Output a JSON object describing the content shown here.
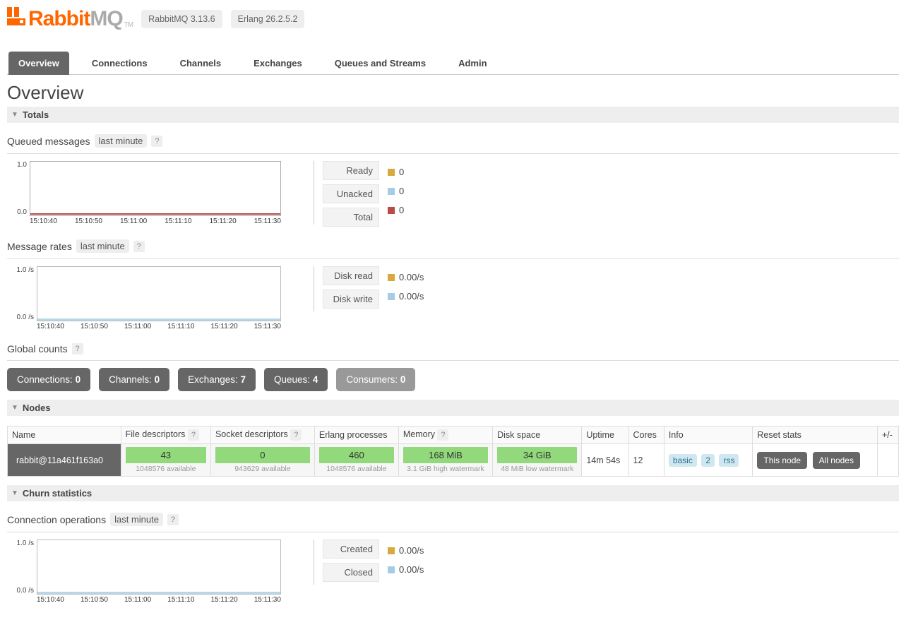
{
  "header": {
    "product_a": "Rabbit",
    "product_b": "MQ",
    "tm": "TM",
    "version": "RabbitMQ 3.13.6",
    "erlang": "Erlang 26.2.5.2"
  },
  "tabs": [
    "Overview",
    "Connections",
    "Channels",
    "Exchanges",
    "Queues and Streams",
    "Admin"
  ],
  "active_tab": 0,
  "page_title": "Overview",
  "sections": {
    "totals": "Totals",
    "nodes": "Nodes",
    "churn": "Churn statistics"
  },
  "queued": {
    "title": "Queued messages",
    "range": "last minute",
    "help": "?",
    "legend": [
      {
        "label": "Ready",
        "value": "0",
        "swatch": "gold"
      },
      {
        "label": "Unacked",
        "value": "0",
        "swatch": "blue"
      },
      {
        "label": "Total",
        "value": "0",
        "swatch": "red"
      }
    ]
  },
  "rates": {
    "title": "Message rates",
    "range": "last minute",
    "help": "?",
    "legend": [
      {
        "label": "Disk read",
        "value": "0.00/s",
        "swatch": "gold"
      },
      {
        "label": "Disk write",
        "value": "0.00/s",
        "swatch": "blue"
      }
    ]
  },
  "chart_data": [
    {
      "type": "line",
      "title": "Queued messages",
      "xlabel": "",
      "ylabel": "",
      "ylim": [
        0,
        1.0
      ],
      "x": [
        "15:10:40",
        "15:10:50",
        "15:11:00",
        "15:11:10",
        "15:11:20",
        "15:11:30"
      ],
      "series": [
        {
          "name": "Ready",
          "values": [
            0,
            0,
            0,
            0,
            0,
            0
          ]
        },
        {
          "name": "Unacked",
          "values": [
            0,
            0,
            0,
            0,
            0,
            0
          ]
        },
        {
          "name": "Total",
          "values": [
            0,
            0,
            0,
            0,
            0,
            0
          ]
        }
      ],
      "y_ticks": [
        "1.0",
        "0.0"
      ]
    },
    {
      "type": "line",
      "title": "Message rates",
      "xlabel": "",
      "ylabel": "/s",
      "ylim": [
        0,
        1.0
      ],
      "x": [
        "15:10:40",
        "15:10:50",
        "15:11:00",
        "15:11:10",
        "15:11:20",
        "15:11:30"
      ],
      "series": [
        {
          "name": "Disk read",
          "values": [
            0,
            0,
            0,
            0,
            0,
            0
          ]
        },
        {
          "name": "Disk write",
          "values": [
            0,
            0,
            0,
            0,
            0,
            0
          ]
        }
      ],
      "y_ticks": [
        "1.0 /s",
        "0.0 /s"
      ]
    },
    {
      "type": "line",
      "title": "Connection operations",
      "xlabel": "",
      "ylabel": "/s",
      "ylim": [
        0,
        1.0
      ],
      "x": [
        "15:10:40",
        "15:10:50",
        "15:11:00",
        "15:11:10",
        "15:11:20",
        "15:11:30"
      ],
      "series": [
        {
          "name": "Created",
          "values": [
            0,
            0,
            0,
            0,
            0,
            0
          ]
        },
        {
          "name": "Closed",
          "values": [
            0,
            0,
            0,
            0,
            0,
            0
          ]
        }
      ],
      "y_ticks": [
        "1.0 /s",
        "0.0 /s"
      ]
    }
  ],
  "global_counts": {
    "title": "Global counts",
    "help": "?",
    "items": [
      {
        "label": "Connections:",
        "value": "0",
        "muted": false
      },
      {
        "label": "Channels:",
        "value": "0",
        "muted": false
      },
      {
        "label": "Exchanges:",
        "value": "7",
        "muted": false
      },
      {
        "label": "Queues:",
        "value": "4",
        "muted": false
      },
      {
        "label": "Consumers:",
        "value": "0",
        "muted": true
      }
    ]
  },
  "nodes": {
    "headers": {
      "name": "Name",
      "fd": "File descriptors",
      "sd": "Socket descriptors",
      "ep": "Erlang processes",
      "mem": "Memory",
      "disk": "Disk space",
      "uptime": "Uptime",
      "cores": "Cores",
      "info": "Info",
      "reset": "Reset stats",
      "pm": "+/-",
      "help": "?"
    },
    "row": {
      "name": "rabbit@11a461f163a0",
      "fd": {
        "val": "43",
        "sub": "1048576 available"
      },
      "sd": {
        "val": "0",
        "sub": "943629 available"
      },
      "ep": {
        "val": "460",
        "sub": "1048576 available"
      },
      "mem": {
        "val": "168 MiB",
        "sub": "3.1 GiB high watermark"
      },
      "disk": {
        "val": "34 GiB",
        "sub": "48 MiB low watermark"
      },
      "uptime": "14m 54s",
      "cores": "12",
      "info": {
        "basic": "basic",
        "num": "2",
        "rss": "rss"
      },
      "reset": {
        "this": "This node",
        "all": "All nodes"
      }
    }
  },
  "churn": {
    "title": "Connection operations",
    "range": "last minute",
    "help": "?",
    "legend": [
      {
        "label": "Created",
        "value": "0.00/s",
        "swatch": "gold"
      },
      {
        "label": "Closed",
        "value": "0.00/s",
        "swatch": "blue"
      }
    ]
  }
}
